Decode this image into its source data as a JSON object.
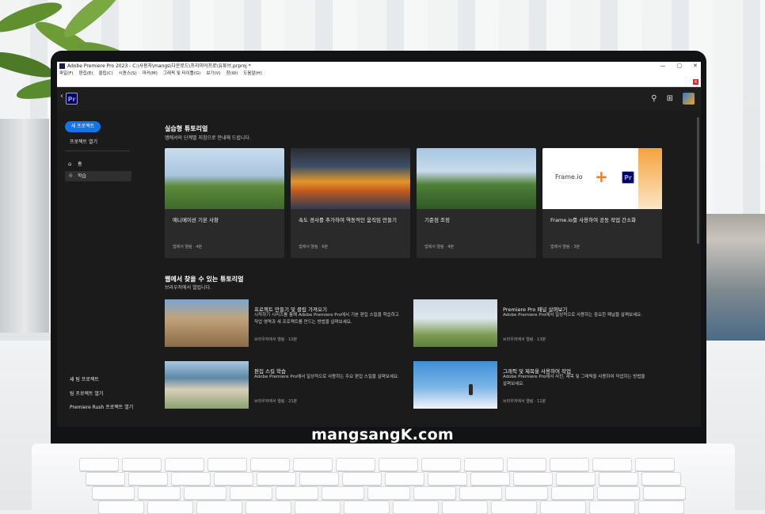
{
  "window": {
    "title": "Adobe Premiere Pro 2023 - C:\\사용자\\mangs\\다운로드\\프리미어프로\\유튜브.prproj *",
    "min": "—",
    "max": "▢",
    "close": "✕",
    "menu": [
      "파일(F)",
      "편집(E)",
      "클립(C)",
      "시퀀스(S)",
      "마커(M)",
      "그래픽 및 타이틀(G)",
      "보기(V)",
      "창(W)",
      "도움말(H)"
    ]
  },
  "header": {
    "back": "‹",
    "logo": "Pr"
  },
  "sidebar": {
    "new_project": "새 프로젝트",
    "open_project": "프로젝트 열기",
    "items": [
      {
        "label": "홈",
        "icon": "home-icon"
      },
      {
        "label": "학습",
        "icon": "lightbulb-icon"
      }
    ],
    "bottom": [
      "새 팀 프로젝트",
      "팀 프로젝트 열기",
      "Premiere Rush 프로젝트 열기"
    ]
  },
  "hands_on": {
    "title": "실습형 튜토리얼",
    "subtitle": "앱에서의 단계별 지침으로 안내해 드립니다.",
    "cards": [
      {
        "title": "애니메이션 기본 사항",
        "meta": "앱에서 열림 · 4분"
      },
      {
        "title": "속도 경사를 추가하여 역동적인 움직임 만들기",
        "meta": "앱에서 열림 · 6분"
      },
      {
        "title": "기준점 조정",
        "meta": "앱에서 열림 · 4분"
      },
      {
        "title": "Frame.io를 사용하여 공동 작업 간소화",
        "meta": "앱에서 열림 · 3분",
        "thumb_text": "Frame.io"
      }
    ]
  },
  "web": {
    "title": "웹에서 찾을 수 있는 튜토리얼",
    "subtitle": "브라우저에서 열립니다.",
    "items": [
      {
        "title": "프로젝트 만들기 및 클립 가져오기",
        "desc": "시작하기 시리즈를 통해 Adobe Premiere Pro에서 기본 편집 스킬을 학습하고 작업 영역과 새 프로젝트를 만드는 방법을 살펴보세요.",
        "meta": "브라우저에서 열림 · 10분"
      },
      {
        "title": "Premiere Pro 패널 살펴보기",
        "desc": "Adobe Premiere Pro에서 일상적으로 사용하는 중요한 패널을 살펴보세요.",
        "meta": "브라우저에서 열림 · 13분"
      },
      {
        "title": "편집 스킬 학습",
        "desc": "Adobe Premiere Pro에서 일상적으로 사용하는 주요 편집 스킬을 살펴보세요.",
        "meta": "브라우저에서 열림 · 21분"
      },
      {
        "title": "그래픽 및 제목을 사용하여 작업",
        "desc": "Adobe Premiere Pro에서 사진, 제목 및 그래픽을 사용하여 작업하는 방법을 살펴보세요.",
        "meta": "브라우저에서 열림 · 11분"
      }
    ]
  },
  "watermark": "mangsangK.com",
  "colors": {
    "accent": "#1473e6",
    "bg": "#1b1b1b",
    "card": "#2a2a2a",
    "pr_brand": "#9999ff"
  }
}
